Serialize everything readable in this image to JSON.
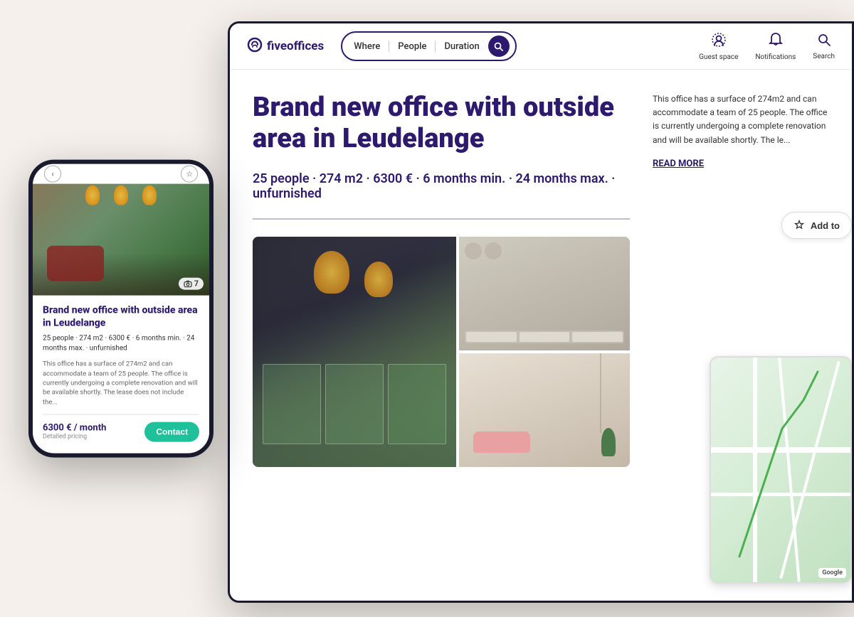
{
  "background_color": "#f5f0eb",
  "phone": {
    "title": "Brand new office with outside area in Leudelange",
    "meta": "25 people · 274 m2 · 6300 € · 6 months min. · 24 months max. · unfurnished",
    "description": "This office has a surface of 274m2 and can accommodate a team of 25 people. The office is currently undergoing a complete renovation and will be available shortly. The lease does not include the...",
    "photo_count": "7",
    "price": "6300 € / month",
    "pricing_link": "Detailed pricing",
    "contact_btn": "Contact"
  },
  "desktop": {
    "logo_text": "fiveoffices",
    "search": {
      "where_label": "Where",
      "people_label": "People",
      "duration_label": "Duration"
    },
    "nav": {
      "guest_space": "Guest space",
      "notifications": "Notifications",
      "search": "Search"
    },
    "listing": {
      "title": "Brand new office with outside area in Leudelange",
      "meta": "25 people · 274 m2 · 6300 € · 6 months min. · 24 months max. · unfurnished",
      "description": "This office has a surface of 274m2 and can accommodate a team of 25 people. The office is currently u...",
      "description_full": "This office has a surface of 274m2 and can accommodate a team of 25 people. The office is currently undergoing a complete renovation and will be available shortly. The le...",
      "read_more": "READ MORE",
      "add_to_label": "Add to"
    }
  }
}
